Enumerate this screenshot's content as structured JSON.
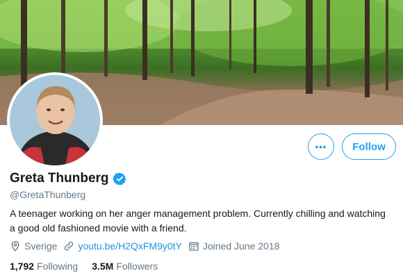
{
  "profile": {
    "name": "Greta Thunberg",
    "handle": "@GretaThunberg",
    "bio": "A teenager working on her anger management problem. Currently chilling and watching a good old fashioned movie with a friend.",
    "location": "Sverige",
    "website": "youtu.be/H2QxFM9y0tY",
    "joined": "Joined June 2018",
    "verified": true
  },
  "actions": {
    "more_label": "•••",
    "follow_label": "Follow"
  },
  "stats": {
    "following_count": "1,792",
    "following_label": "Following",
    "followers_count": "3.5M",
    "followers_label": "Followers"
  },
  "icons": {
    "location": "location-pin-icon",
    "link": "link-icon",
    "calendar": "calendar-icon",
    "verified": "verified-badge-icon"
  },
  "colors": {
    "accent": "#1da1f2",
    "link": "#1b95e0",
    "muted": "#657786",
    "text": "#14171a"
  }
}
